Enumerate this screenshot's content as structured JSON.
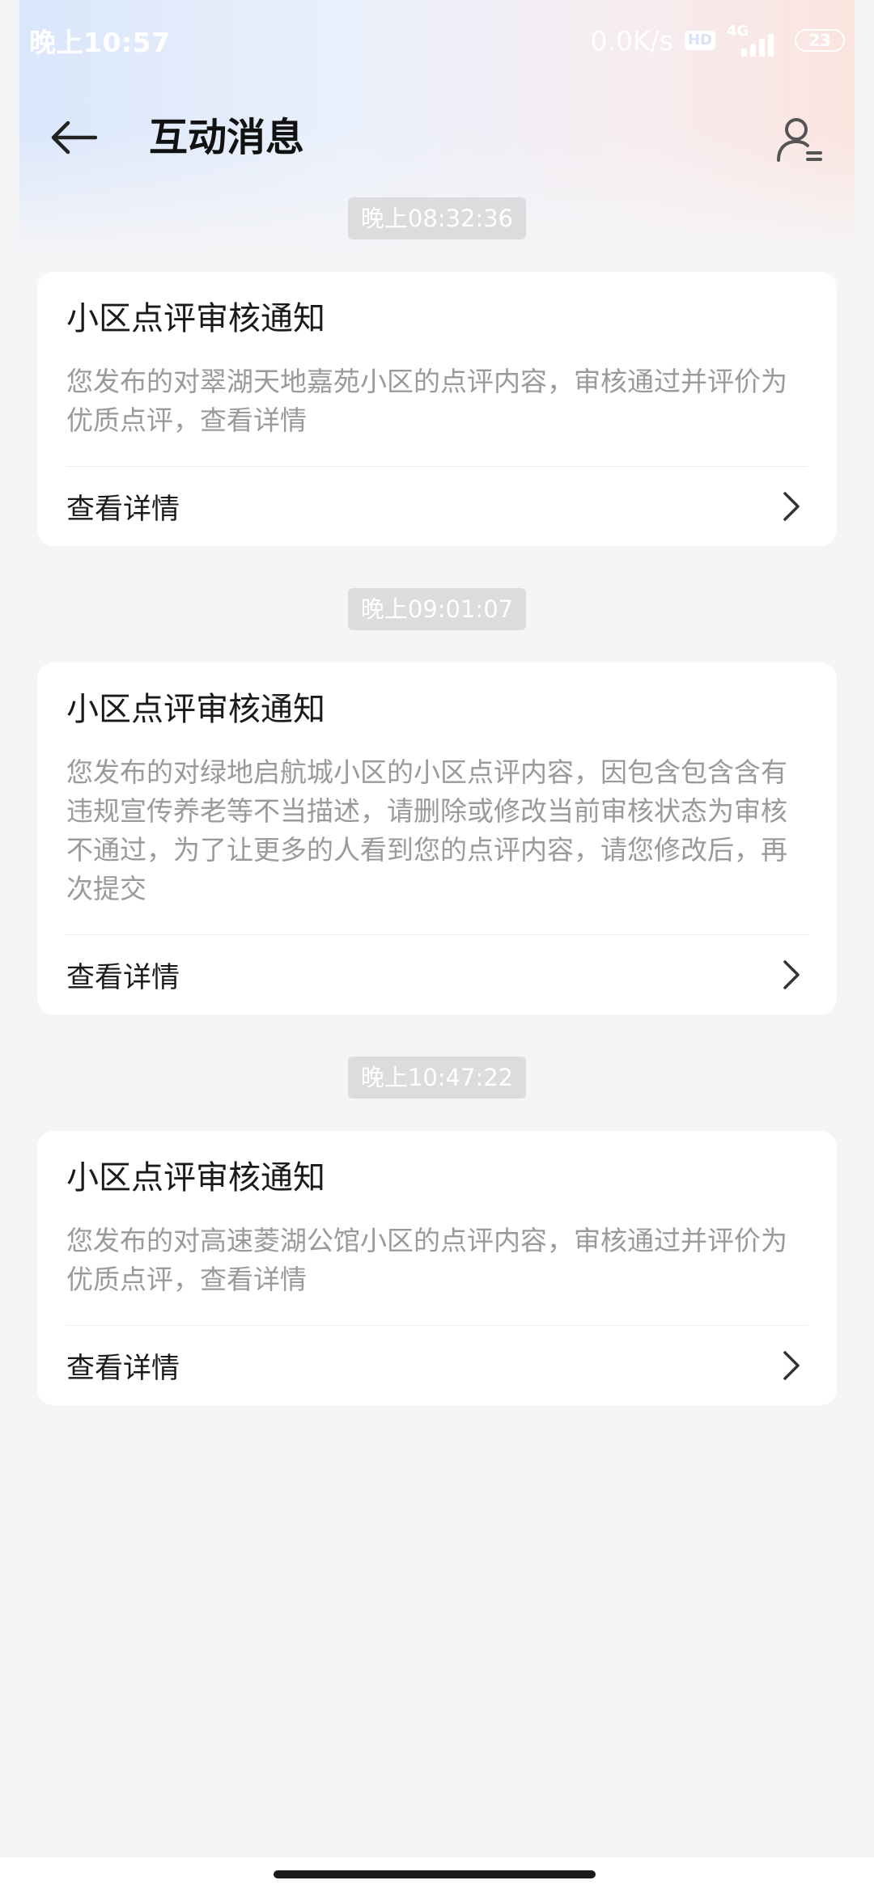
{
  "status_bar": {
    "time": "晚上10:57",
    "net_speed": "0.0K/s",
    "hd_label": "HD",
    "network_type": "4G",
    "battery_level": "23"
  },
  "header": {
    "title": "互动消息"
  },
  "messages": [
    {
      "time": "晚上08:32:36",
      "title": "小区点评审核通知",
      "body": "您发布的对翠湖天地嘉苑小区的点评内容，审核通过并评价为优质点评，查看详情",
      "action_label": "查看详情"
    },
    {
      "time": "晚上09:01:07",
      "title": "小区点评审核通知",
      "body": "您发布的对绿地启航城小区的小区点评内容，因包含包含含有违规宣传养老等不当描述，请删除或修改当前审核状态为审核不通过，为了让更多的人看到您的点评内容，请您修改后，再次提交",
      "action_label": "查看详情"
    },
    {
      "time": "晚上10:47:22",
      "title": "小区点评审核通知",
      "body": "您发布的对高速菱湖公馆小区的点评内容，审核通过并评价为优质点评，查看详情",
      "action_label": "查看详情"
    }
  ],
  "colors": {
    "title_text": "#111111",
    "body_text": "#9a9a9a",
    "time_pill_bg": "#dcdcde",
    "card_bg": "#ffffff",
    "page_bg": "#f5f5f7"
  },
  "icons": {
    "back": "arrow-left-icon",
    "profile": "user-settings-icon",
    "action": "chevron-right-icon"
  }
}
